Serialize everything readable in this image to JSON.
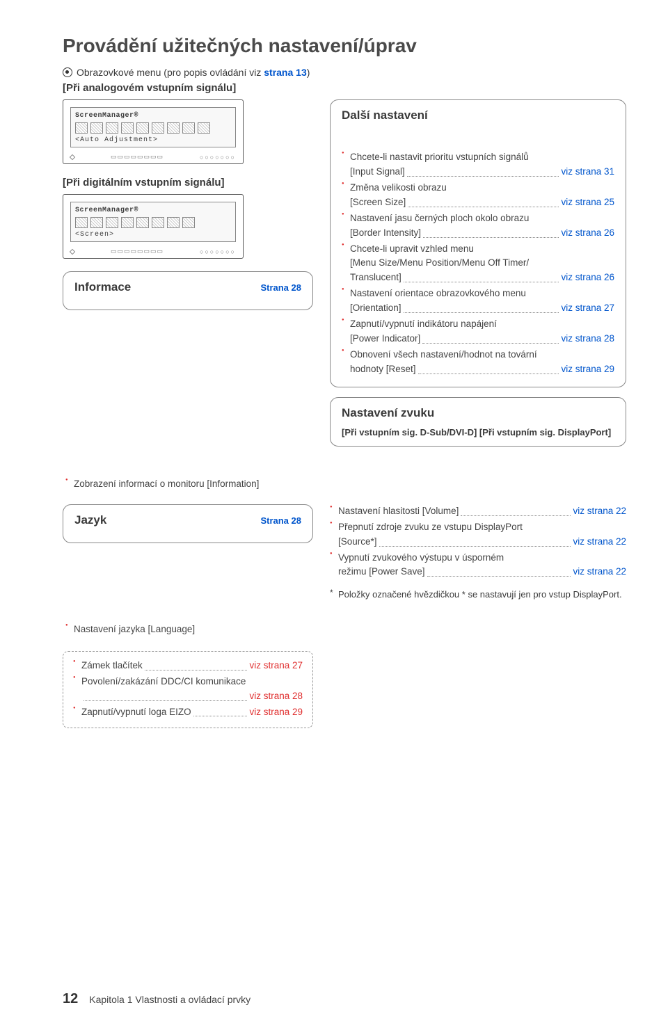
{
  "title": "Provádění užitečných nastavení/úprav",
  "intro": {
    "prefix": "Obrazovkové menu (pro popis ovládání viz ",
    "link": "strana 13",
    "suffix": ")"
  },
  "analog_label": "[Při analogovém vstupním signálu]",
  "digital_label": "[Při digitálním vstupním signálu]",
  "osd1": {
    "brand": "ScreenManager®",
    "label": "<Auto Adjustment>"
  },
  "osd2": {
    "brand": "ScreenManager®",
    "label": "<Screen>"
  },
  "others": {
    "title": "Další nastavení",
    "items": [
      {
        "text": "Chcete-li nastavit prioritu vstupních signálů",
        "sub": "[Input Signal]",
        "ref": "viz strana 31"
      },
      {
        "text": "Změna velikosti obrazu",
        "sub": "[Screen Size]",
        "ref": "viz strana 25"
      },
      {
        "text": "Nastavení jasu černých ploch okolo obrazu",
        "sub": "[Border Intensity]",
        "ref": "viz strana 26"
      },
      {
        "text": "Chcete-li upravit vzhled menu",
        "sub": "[Menu Size/Menu Position/Menu Off Timer/Translucent]",
        "ref": "viz strana 26"
      },
      {
        "text": "Nastavení orientace obrazovkového menu",
        "sub": "[Orientation]",
        "ref": "viz strana 27"
      },
      {
        "text": "Zapnutí/vypnutí indikátoru napájení",
        "sub": "[Power Indicator]",
        "ref": "viz strana 28"
      },
      {
        "text": "Obnovení všech nastavení/hodnot na tovární hodnoty [Reset]",
        "sub": "",
        "ref": "viz strana 29",
        "inline": true
      }
    ]
  },
  "info": {
    "title": "Informace",
    "page": "Strana 28",
    "item": "Zobrazení informací o monitoru [Information]"
  },
  "sound": {
    "title": "Nastavení zvuku",
    "tags": "[Při vstupním sig. D-Sub/DVI-D] [Při vstupním sig. DisplayPort]",
    "items": [
      {
        "lead": "Nastavení hlasitosti [Volume]",
        "ref": "viz strana 22"
      },
      {
        "text": "Přepnutí zdroje zvuku ze vstupu DisplayPort",
        "sub": "[Source*]",
        "ref": "viz strana 22"
      },
      {
        "text": "Vypnutí zvukového výstupu v úsporném",
        "sub": "režimu [Power Save]",
        "ref": "viz strana 22"
      }
    ],
    "note": "Položky označené hvězdičkou * se nastavují jen pro vstup DisplayPort."
  },
  "lang": {
    "title": "Jazyk",
    "page": "Strana 28",
    "item": "Nastavení jazyka [Language]"
  },
  "extras": {
    "items": [
      {
        "lead": "Zámek tlačítek",
        "ref": "viz strana 27"
      },
      {
        "text": "Povolení/zakázání DDC/CI komunikace",
        "ref": "viz strana 28"
      },
      {
        "lead": "Zapnutí/vypnutí loga EIZO",
        "ref": "viz strana 29"
      }
    ]
  },
  "footer": {
    "num": "12",
    "text": "Kapitola 1  Vlastnosti a ovládací prvky"
  }
}
